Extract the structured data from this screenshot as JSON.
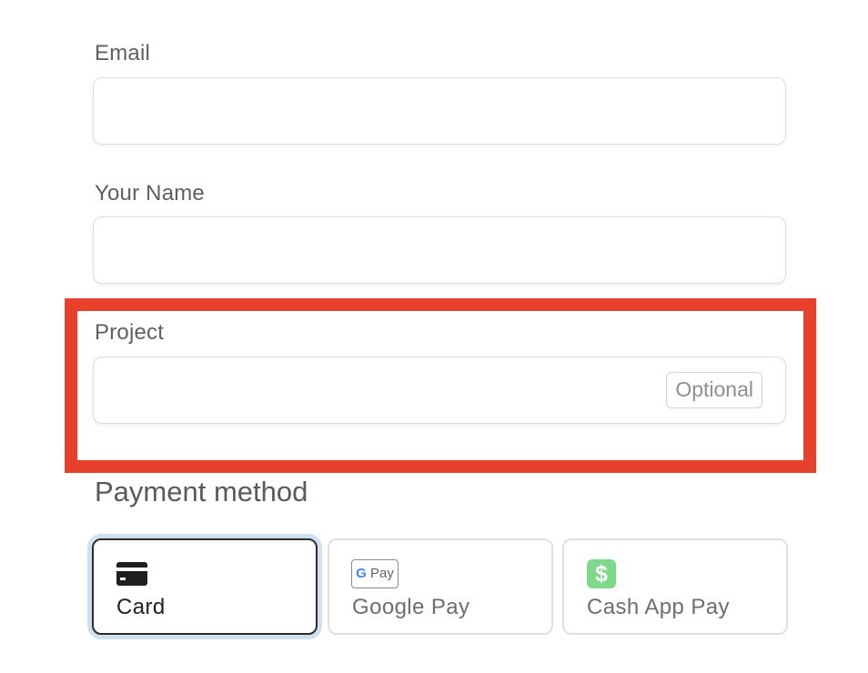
{
  "form": {
    "email": {
      "label": "Email",
      "value": "",
      "placeholder": ""
    },
    "name": {
      "label": "Your Name",
      "value": "",
      "placeholder": ""
    },
    "project": {
      "label": "Project",
      "value": "",
      "placeholder": "",
      "badge": "Optional"
    }
  },
  "payment": {
    "title": "Payment method",
    "selected": "card",
    "options": [
      {
        "id": "card",
        "label": "Card",
        "icon": "credit-card-icon"
      },
      {
        "id": "google-pay",
        "label": "Google Pay",
        "icon": "google-pay-icon",
        "icon_text_g": "G",
        "icon_text_pay": "Pay"
      },
      {
        "id": "cash-app-pay",
        "label": "Cash App Pay",
        "icon": "cash-app-icon",
        "icon_text": "$"
      }
    ]
  },
  "colors": {
    "highlight": "#e8412b",
    "selected_ring": "#cfe1f0",
    "cash_app_green": "#7ed88a"
  }
}
